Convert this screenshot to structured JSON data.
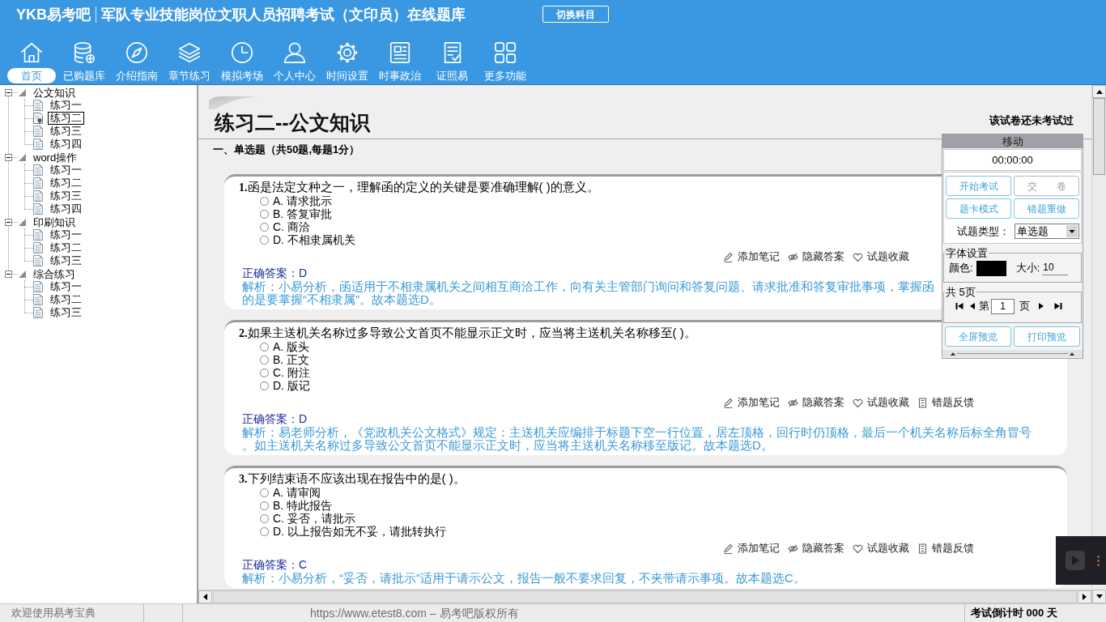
{
  "header": {
    "logo": "YKB易考吧",
    "title": "军队专业技能岗位文职人员招聘考试（文印员）在线题库",
    "switch_button": "切换科目"
  },
  "toolbar": [
    {
      "label": "首页",
      "selected": true
    },
    {
      "label": "已购题库",
      "selected": false
    },
    {
      "label": "介绍指南",
      "selected": false
    },
    {
      "label": "章节练习",
      "selected": false
    },
    {
      "label": "模拟考场",
      "selected": false
    },
    {
      "label": "个人中心",
      "selected": false
    },
    {
      "label": "时间设置",
      "selected": false
    },
    {
      "label": "时事政治",
      "selected": false
    },
    {
      "label": "证照易",
      "selected": false
    },
    {
      "label": "更多功能",
      "selected": false
    }
  ],
  "tree": [
    {
      "label": "公文知识",
      "expanded": true,
      "children": [
        {
          "label": "练习一",
          "selected": false
        },
        {
          "label": "练习二",
          "selected": true
        },
        {
          "label": "练习三",
          "selected": false
        },
        {
          "label": "练习四",
          "selected": false
        }
      ]
    },
    {
      "label": "word操作",
      "expanded": true,
      "children": [
        {
          "label": "练习一",
          "selected": false
        },
        {
          "label": "练习二",
          "selected": false
        },
        {
          "label": "练习三",
          "selected": false
        },
        {
          "label": "练习四",
          "selected": false
        }
      ]
    },
    {
      "label": "印刷知识",
      "expanded": true,
      "children": [
        {
          "label": "练习一",
          "selected": false
        },
        {
          "label": "练习二",
          "selected": false
        },
        {
          "label": "练习三",
          "selected": false
        }
      ]
    },
    {
      "label": "综合练习",
      "expanded": true,
      "children": [
        {
          "label": "练习一",
          "selected": false
        },
        {
          "label": "练习二",
          "selected": false
        },
        {
          "label": "练习三",
          "selected": false
        }
      ]
    }
  ],
  "exam": {
    "title": "练习二--公文知识",
    "status": "该试卷还未考试过",
    "section": "一、单选题（共50题,每题1分）",
    "questions": [
      {
        "number": "1.",
        "text": "函是法定文种之一，理解函的定义的关键是要准确理解( )的意义。",
        "options": [
          {
            "label": "A. 请求批示",
            "selected": false
          },
          {
            "label": "B. 答复审批",
            "selected": false
          },
          {
            "label": "C. 商洽",
            "selected": false
          },
          {
            "label": "D. 不相隶属机关",
            "selected": false
          }
        ],
        "actions": [
          "添加笔记",
          "隐藏答案",
          "试题收藏"
        ],
        "answer": "正确答案：D",
        "analysis": [
          "解析：小易分析，函适用于不相隶属机关之间相互商洽工作，向有关主管部门询问和答复问题、请求批准和答复审批事项，掌握函",
          "的是要掌握“不相隶属”。故本题选D。"
        ]
      },
      {
        "number": "2.",
        "text": "如果主送机关名称过多导致公文首页不能显示正文时，应当将主送机关名称移至( )。",
        "options": [
          {
            "label": "A. 版头",
            "selected": false
          },
          {
            "label": "B. 正文",
            "selected": false
          },
          {
            "label": "C. 附注",
            "selected": false
          },
          {
            "label": "D. 版记",
            "selected": false
          }
        ],
        "actions": [
          "添加笔记",
          "隐藏答案",
          "试题收藏",
          "错题反馈"
        ],
        "answer": "正确答案：D",
        "analysis": [
          "解析：易老师分析，《党政机关公文格式》规定：主送机关应编排于标题下空一行位置，居左顶格，回行时仍顶格，最后一个机关名称后标全角冒号。如主送机关名称过多导致公文首页不能显示正文时，应当将主送机关名称移至版记。故本题选D。"
        ]
      },
      {
        "number": "3.",
        "text": "下列结束语不应该出现在报告中的是( )。",
        "options": [
          {
            "label": "A. 请审阅",
            "selected": false
          },
          {
            "label": "B. 特此报告",
            "selected": false
          },
          {
            "label": "C. 妥否，请批示",
            "selected": false
          },
          {
            "label": "D. 以上报告如无不妥，请批转执行",
            "selected": false
          }
        ],
        "actions": [
          "添加笔记",
          "隐藏答案",
          "试题收藏",
          "错题反馈"
        ],
        "answer": "正确答案：C",
        "analysis": [
          "解析：小易分析，“妥否，请批示”适用于请示公文，报告一般不要求回复，不夹带请示事项。故本题选C。"
        ]
      }
    ]
  },
  "panel": {
    "title": "移动",
    "timer": "00:00:00",
    "buttons": [
      {
        "label": "开始考试",
        "disabled": false
      },
      {
        "label": "交　　卷",
        "disabled": true
      },
      {
        "label": "题卡模式",
        "disabled": false
      },
      {
        "label": "错题重做",
        "disabled": false
      }
    ],
    "type_label": "试题类型：",
    "type_value": "单选题",
    "font": {
      "legend": "字体设置",
      "color_label": "颜色:",
      "color": "#000000",
      "size_label": "大小:",
      "size": "10"
    },
    "pager": {
      "legend": "共 5页",
      "page_prefix": "第",
      "page": "1",
      "page_suffix": "页"
    },
    "preview_buttons": [
      "全屏预览",
      "打印预览"
    ]
  },
  "status_bar": {
    "welcome": "欢迎使用易考宝典",
    "copyright": "https://www.etest8.com – 易考吧版权所有",
    "countdown": "考试倒计时 000 天"
  }
}
